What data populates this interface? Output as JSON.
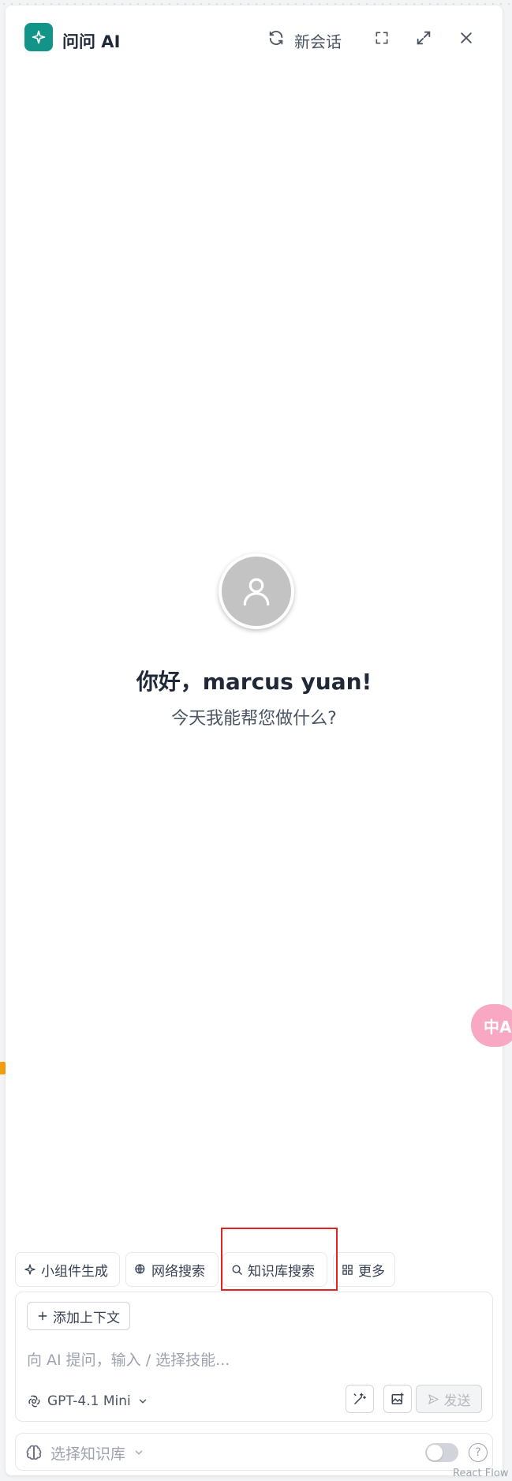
{
  "header": {
    "title": "问问 AI",
    "new_chat_label": "新会话"
  },
  "welcome": {
    "greeting": "你好，marcus yuan!",
    "subtitle": "今天我能帮您做什么?"
  },
  "quick_actions": [
    {
      "label": "小组件生成",
      "icon": "sparkle-icon"
    },
    {
      "label": "网络搜索",
      "icon": "globe-search-icon"
    },
    {
      "label": "知识库搜索",
      "icon": "search-icon",
      "highlighted": true
    },
    {
      "label": "更多",
      "icon": "grid-icon"
    }
  ],
  "composer": {
    "add_context_label": "添加上下文",
    "placeholder": "向 AI 提问，输入 / 选择技能...",
    "value": "",
    "model_label": "GPT-4.1 Mini",
    "send_label": "发送"
  },
  "knowledge_bar": {
    "select_label": "选择知识库",
    "toggle_on": false,
    "help_symbol": "?"
  },
  "translate_fab_label": "中A",
  "watermark": "React Flow",
  "colors": {
    "brand": "#129488",
    "highlight_border": "#e02424",
    "avatar_bg": "#c3c3c3",
    "fab_bg": "#f9a8c4"
  }
}
